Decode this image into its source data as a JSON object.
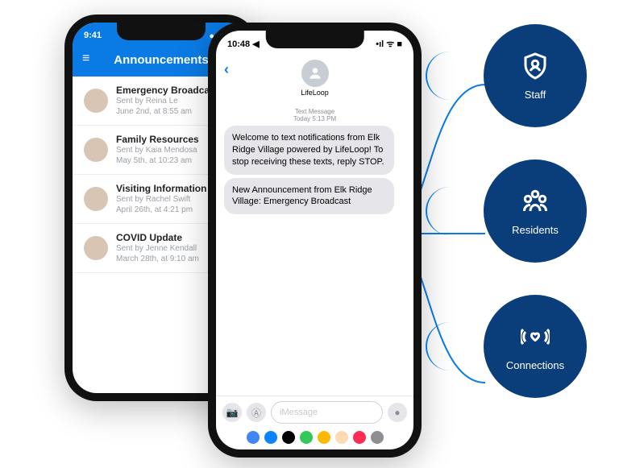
{
  "phone1": {
    "status_time": "9:41",
    "header": "Announcements",
    "items": [
      {
        "title": "Emergency Broadcast",
        "sender": "Sent by Reina Le",
        "time": "June 2nd, at 8:55 am"
      },
      {
        "title": "Family Resources",
        "sender": "Sent by Kaia Mendosa",
        "time": "May 5th, at 10:23 am"
      },
      {
        "title": "Visiting Information",
        "sender": "Sent by Rachel Swift",
        "time": "April 26th, at 4:21 pm"
      },
      {
        "title": "COVID Update",
        "sender": "Sent by Jenne Kendall",
        "time": "March 28th, at 9:10 am"
      }
    ]
  },
  "phone2": {
    "status_time": "10:48 ◀",
    "contact": "LifeLoop",
    "meta_line1": "Text Message",
    "meta_line2": "Today 5:13 PM",
    "messages": [
      "Welcome to text notifications from Elk Ridge Village powered by LifeLoop! To stop receiving these texts, reply STOP.",
      "New Announcement from Elk Ridge Village:\nEmergency Broadcast"
    ],
    "input_placeholder": "iMessage"
  },
  "badges": {
    "staff": "Staff",
    "residents": "Residents",
    "connections": "Connections"
  }
}
